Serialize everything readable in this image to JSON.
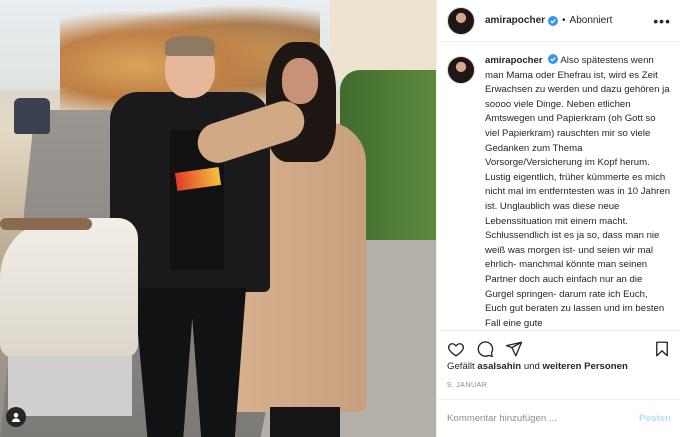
{
  "post": {
    "username": "amirapocher",
    "separator": "•",
    "follow_status": "Abonniert",
    "more_icon": "more-options-icon",
    "verified_color": "#3897f0"
  },
  "caption": {
    "username": "amirapocher",
    "text": "Also spätestens wenn man Mama oder Ehefrau ist, wird es Zeit Erwachsen zu werden und dazu gehören ja soooo viele Dinge. Neben etlichen Amtswegen und Papierkram (oh Gott so viel Papierkram) rauschten mir so viele Gedanken zum Thema Vorsorge/Versicherung im Kopf herum. Lustig eigentlich, früher kümmerte es mich nicht mal im entferntesten was in 10 Jahren ist. Unglaublich was diese neue Lebenssituation mit einem macht. Schlussendlich ist es ja so, dass man nie weiß was morgen ist- und seien wir mal ehrlich- manchmal könnte man seinen Partner doch auch einfach nur an die Gurgel springen- darum rate ich Euch, Euch gut beraten zu lassen und im besten Fall eine gute"
  },
  "actions": {
    "like_icon": "heart-icon",
    "comment_icon": "comment-icon",
    "share_icon": "share-icon",
    "save_icon": "bookmark-icon"
  },
  "likes": {
    "prefix": "Gefällt",
    "user": "asalsahin",
    "middle": "und",
    "others": "weiteren Personen"
  },
  "date": "9. JANUAR",
  "comment": {
    "placeholder": "Kommentar hinzufügen ...",
    "post_label": "Posten",
    "post_color": "#b2dffc"
  },
  "photo": {
    "user_tag_icon": "user-tag-icon"
  }
}
